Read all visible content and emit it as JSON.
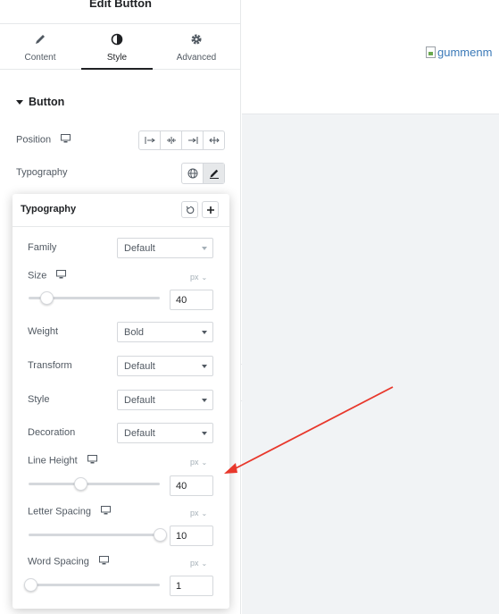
{
  "panel": {
    "title": "Edit Button",
    "tabs": [
      {
        "label": "Content",
        "icon": "pencil-icon",
        "active": false
      },
      {
        "label": "Style",
        "icon": "half-circle-icon",
        "active": true
      },
      {
        "label": "Advanced",
        "icon": "gear-icon",
        "active": false
      }
    ],
    "section": {
      "title": "Button"
    },
    "position": {
      "label": "Position",
      "device_icon": "desktop-icon",
      "options": [
        "align-start-icon",
        "align-center-icon",
        "align-end-icon",
        "align-stretch-icon"
      ]
    },
    "typography": {
      "label": "Typography",
      "globe_icon": "globe-icon",
      "edit_icon": "pencil-icon"
    }
  },
  "popover": {
    "title": "Typography",
    "family": {
      "label": "Family",
      "value": "Default"
    },
    "size": {
      "label": "Size",
      "unit": "px",
      "value": "40",
      "level": 0.14
    },
    "weight": {
      "label": "Weight",
      "value": "Bold"
    },
    "transform": {
      "label": "Transform",
      "value": "Default"
    },
    "style": {
      "label": "Style",
      "value": "Default"
    },
    "decoration": {
      "label": "Decoration",
      "value": "Default"
    },
    "line_height": {
      "label": "Line Height",
      "unit": "px",
      "value": "40",
      "level": 0.4
    },
    "letter_spacing": {
      "label": "Letter Spacing",
      "unit": "px",
      "value": "10",
      "level": 1.0
    },
    "word_spacing": {
      "label": "Word Spacing",
      "unit": "px",
      "value": "1",
      "level": 0.0
    }
  },
  "preview": {
    "image_alt": "gummenm"
  },
  "colors": {
    "annotation_arrow": "#e8372b",
    "link": "#3a79b8",
    "canvas_bg": "#f1f3f5"
  }
}
